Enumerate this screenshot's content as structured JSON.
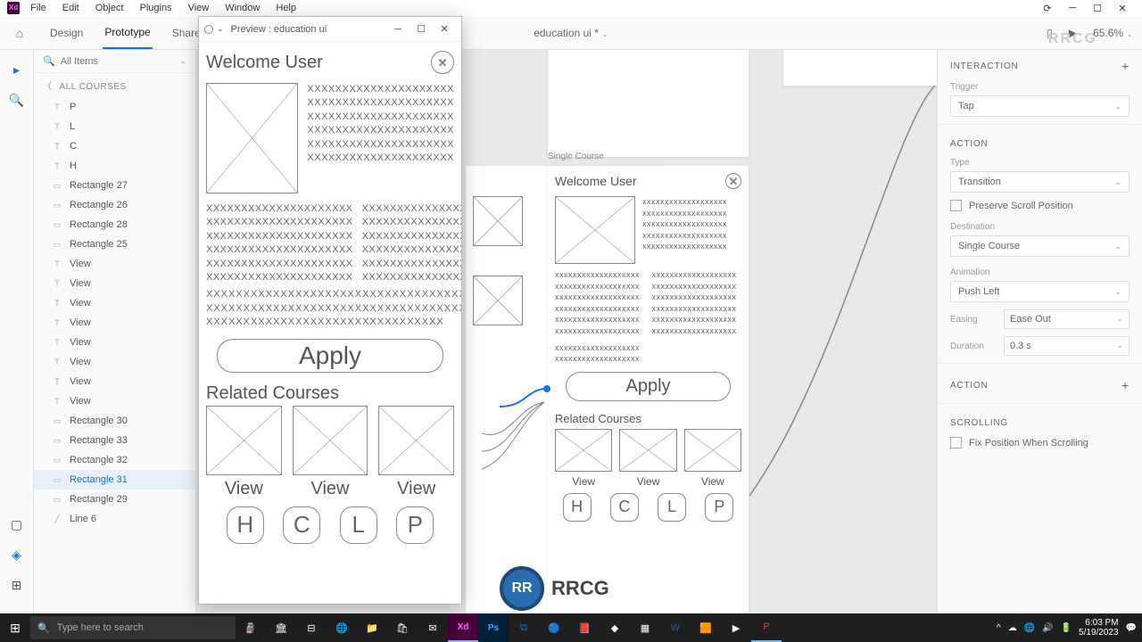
{
  "menubar": {
    "items": [
      "File",
      "Edit",
      "Object",
      "Plugins",
      "View",
      "Window",
      "Help"
    ]
  },
  "toolbar": {
    "tabs": [
      "Design",
      "Prototype",
      "Share"
    ],
    "active_tab": "Prototype",
    "doc_title": "education ui *",
    "zoom": "65.6%"
  },
  "layers": {
    "search_placeholder": "All Items",
    "crumb": "ALL COURSES",
    "items": [
      {
        "icon": "T",
        "label": "P"
      },
      {
        "icon": "T",
        "label": "L"
      },
      {
        "icon": "T",
        "label": "C"
      },
      {
        "icon": "T",
        "label": "H"
      },
      {
        "icon": "R",
        "label": "Rectangle 27"
      },
      {
        "icon": "R",
        "label": "Rectangle 26"
      },
      {
        "icon": "R",
        "label": "Rectangle 28"
      },
      {
        "icon": "R",
        "label": "Rectangle 25"
      },
      {
        "icon": "T",
        "label": "View"
      },
      {
        "icon": "T",
        "label": "View"
      },
      {
        "icon": "T",
        "label": "View"
      },
      {
        "icon": "T",
        "label": "View"
      },
      {
        "icon": "T",
        "label": "View"
      },
      {
        "icon": "T",
        "label": "View"
      },
      {
        "icon": "T",
        "label": "View"
      },
      {
        "icon": "T",
        "label": "View"
      },
      {
        "icon": "R",
        "label": "Rectangle 30"
      },
      {
        "icon": "R",
        "label": "Rectangle 33"
      },
      {
        "icon": "R",
        "label": "Rectangle 32"
      },
      {
        "icon": "R",
        "label": "Rectangle 31"
      },
      {
        "icon": "R",
        "label": "Rectangle 29"
      },
      {
        "icon": "L",
        "label": "Line 6"
      }
    ],
    "selected_index": 19
  },
  "canvas": {
    "artboard_label": "Single Course",
    "wire": {
      "header": "Welcome User",
      "placeholder": "xxxxxxxxxxxxxxxxxxx",
      "apply": "Apply",
      "related": "Related Courses",
      "view": "View",
      "nav": [
        "H",
        "C",
        "L",
        "P"
      ]
    }
  },
  "rpanel": {
    "interaction_hdr": "INTERACTION",
    "trigger_lbl": "Trigger",
    "trigger_val": "Tap",
    "action_hdr": "ACTION",
    "type_lbl": "Type",
    "type_val": "Transition",
    "preserve": "Preserve Scroll Position",
    "dest_lbl": "Destination",
    "dest_val": "Single Course",
    "anim_lbl": "Animation",
    "anim_val": "Push Left",
    "easing_lbl": "Easing",
    "easing_val": "Ease Out",
    "duration_lbl": "Duration",
    "duration_val": "0.3 s",
    "scrolling_hdr": "SCROLLING",
    "fix_pos": "Fix Position When Scrolling"
  },
  "preview": {
    "title": "Preview : education ui",
    "body": {
      "header": "Welcome User",
      "placeholder_long": "XXXXXXXXXXXXXXXXXXXXX",
      "apply": "Apply",
      "related": "Related Courses",
      "view": "View",
      "nav": [
        "H",
        "C",
        "L",
        "P"
      ]
    }
  },
  "taskbar": {
    "search_placeholder": "Type here to search",
    "time": "6:03 PM",
    "date": "5/19/2023"
  },
  "watermark": "RRCG",
  "watermark2": "RRCG"
}
